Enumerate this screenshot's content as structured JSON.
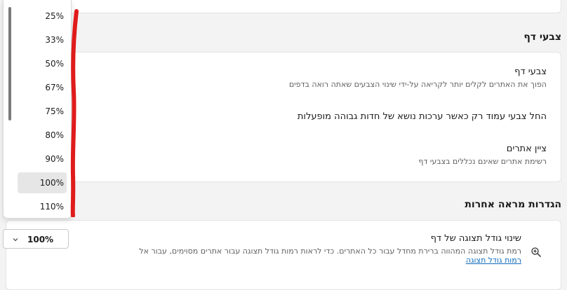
{
  "top_card": {},
  "page_colors": {
    "section_title": "צבעי דף",
    "rows": [
      {
        "title": "צבעי דף",
        "desc": "הפוך את האתרים לקלים יותר לקריאה על-ידי שינוי הצבעים שאתה רואה בדפים"
      },
      {
        "title": "החל צבעי עמוד רק כאשר ערכות נושא של חדות גבוהה מופעלות",
        "desc": ""
      },
      {
        "title": "ציין אתרים",
        "desc": "רשימת אתרים שאינם נכללים בצבעי דף"
      }
    ]
  },
  "other_settings": {
    "section_title": "הגדרות מראה אחרות",
    "zoom_title": "שינוי גודל תצוגה של דף",
    "zoom_desc": "רמת גודל תצוגה המהווה ברירת מחדל עבור כל האתרים. כדי לראות רמות גודל תצוגה עבור אתרים מסוימים, עבור אל",
    "zoom_link": "רמות גודל תצוגה",
    "zoom_icon": "zoom-in-icon"
  },
  "zoom_select": {
    "value": "100%",
    "options": [
      "25%",
      "33%",
      "50%",
      "67%",
      "75%",
      "80%",
      "90%",
      "100%",
      "110%"
    ],
    "selected_index": 7
  },
  "colors": {
    "accent": "#0f6cbd",
    "annotation": "#e01b1b"
  }
}
